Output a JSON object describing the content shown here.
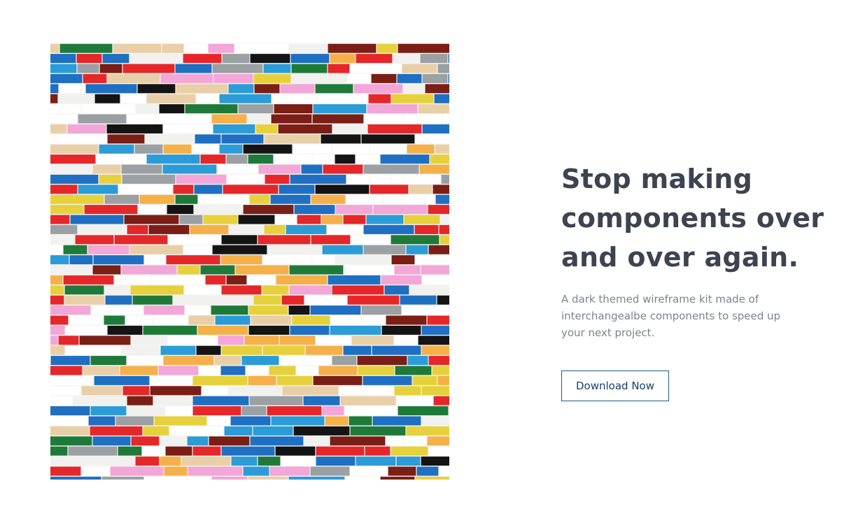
{
  "hero": {
    "image_alt": "Wall of colorful interlocking toy bricks",
    "headline": "Stop making components over and over again.",
    "description": "A dark themed wireframe kit made of interchangealbe components to speed up your next project.",
    "cta_label": "Download Now"
  },
  "colors": {
    "headline": "#3d4350",
    "body_text": "#7c8390",
    "button_border": "#1e5a8a",
    "button_text": "#14406a",
    "brick_palette": [
      "#ffffff",
      "#ffffff",
      "#ffffff",
      "#f1f1ef",
      "#1f6fc2",
      "#1f6fc2",
      "#e5272a",
      "#e5272a",
      "#f5b049",
      "#141414",
      "#9aa0a3",
      "#2b9cd8",
      "#e6d13c",
      "#7a1e16",
      "#1f7a3a",
      "#f3a6d8",
      "#e9cfa8"
    ]
  }
}
